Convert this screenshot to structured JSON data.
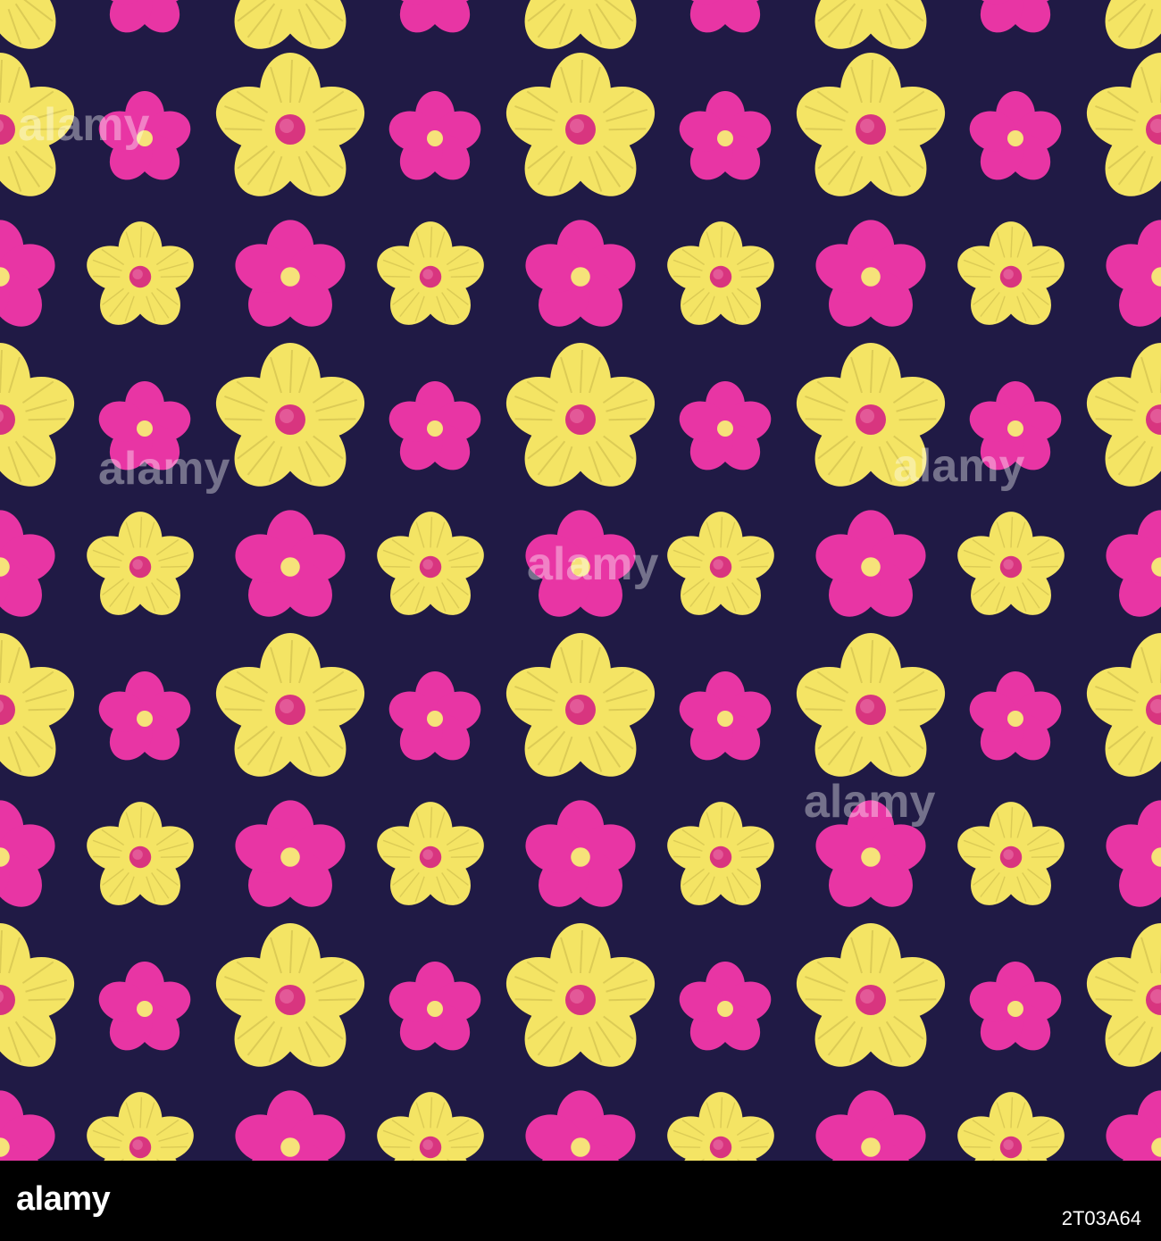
{
  "image": {
    "background_color": "#201a45",
    "yellow_flower_color": "#f4e464",
    "pink_flower_color": "#e835a4",
    "description_type": "seamless floral pattern"
  },
  "watermark": {
    "text": "alamy"
  },
  "footer": {
    "logo": "alamy",
    "image_id": "2T03A64"
  }
}
